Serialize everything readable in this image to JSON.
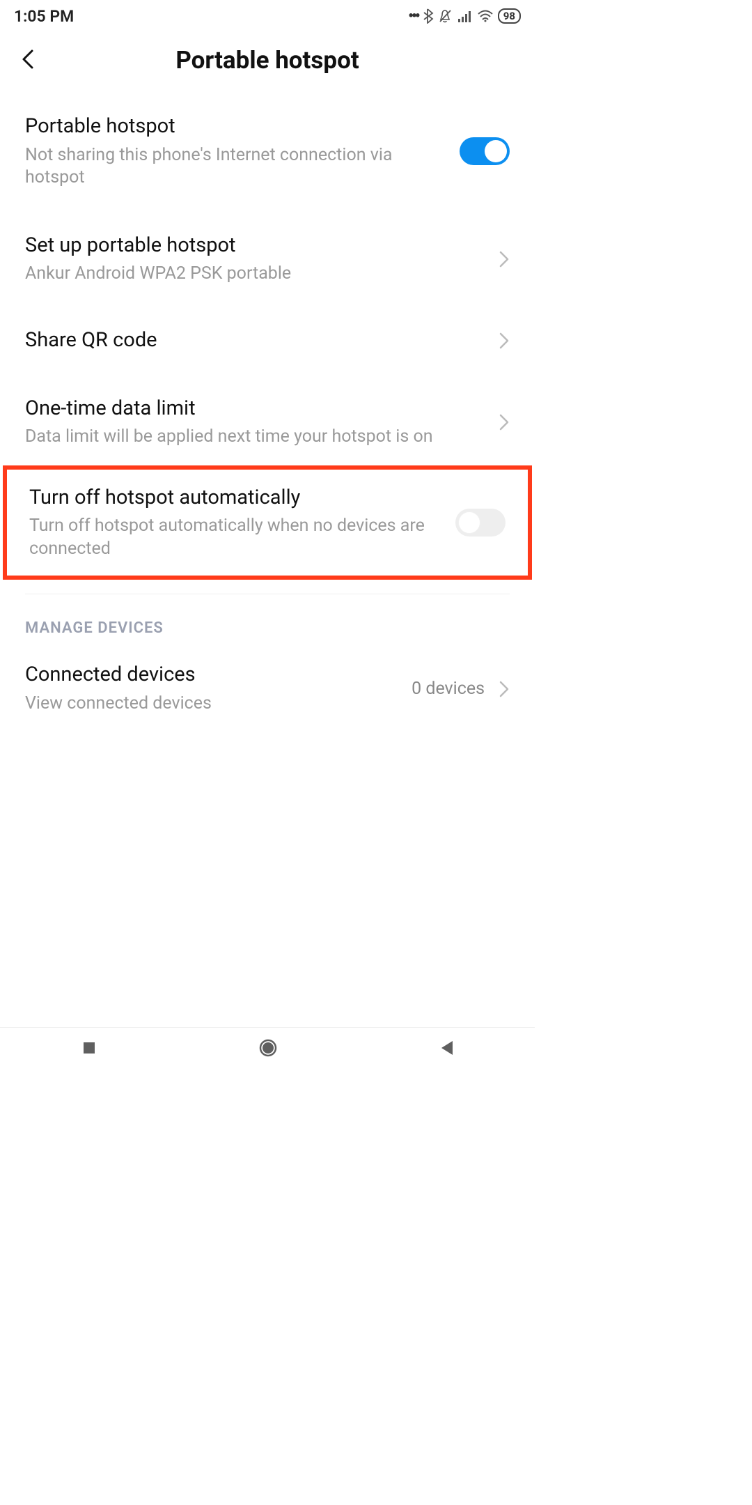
{
  "status": {
    "time": "1:05 PM",
    "battery": "98"
  },
  "header": {
    "title": "Portable hotspot"
  },
  "settings": {
    "hotspot": {
      "title": "Portable hotspot",
      "subtitle": "Not sharing this phone's Internet connection via hotspot",
      "enabled": true
    },
    "setup": {
      "title": "Set up portable hotspot",
      "subtitle": "Ankur Android WPA2 PSK portable"
    },
    "qr": {
      "title": "Share QR code"
    },
    "data_limit": {
      "title": "One-time data limit",
      "subtitle": "Data limit will be applied next time your hotspot is on"
    },
    "auto_off": {
      "title": "Turn off hotspot automatically",
      "subtitle": "Turn off hotspot automatically when no devices are connected",
      "enabled": false
    }
  },
  "section": {
    "manage": "MANAGE DEVICES"
  },
  "devices": {
    "title": "Connected devices",
    "subtitle": "View connected devices",
    "value": "0 devices"
  }
}
